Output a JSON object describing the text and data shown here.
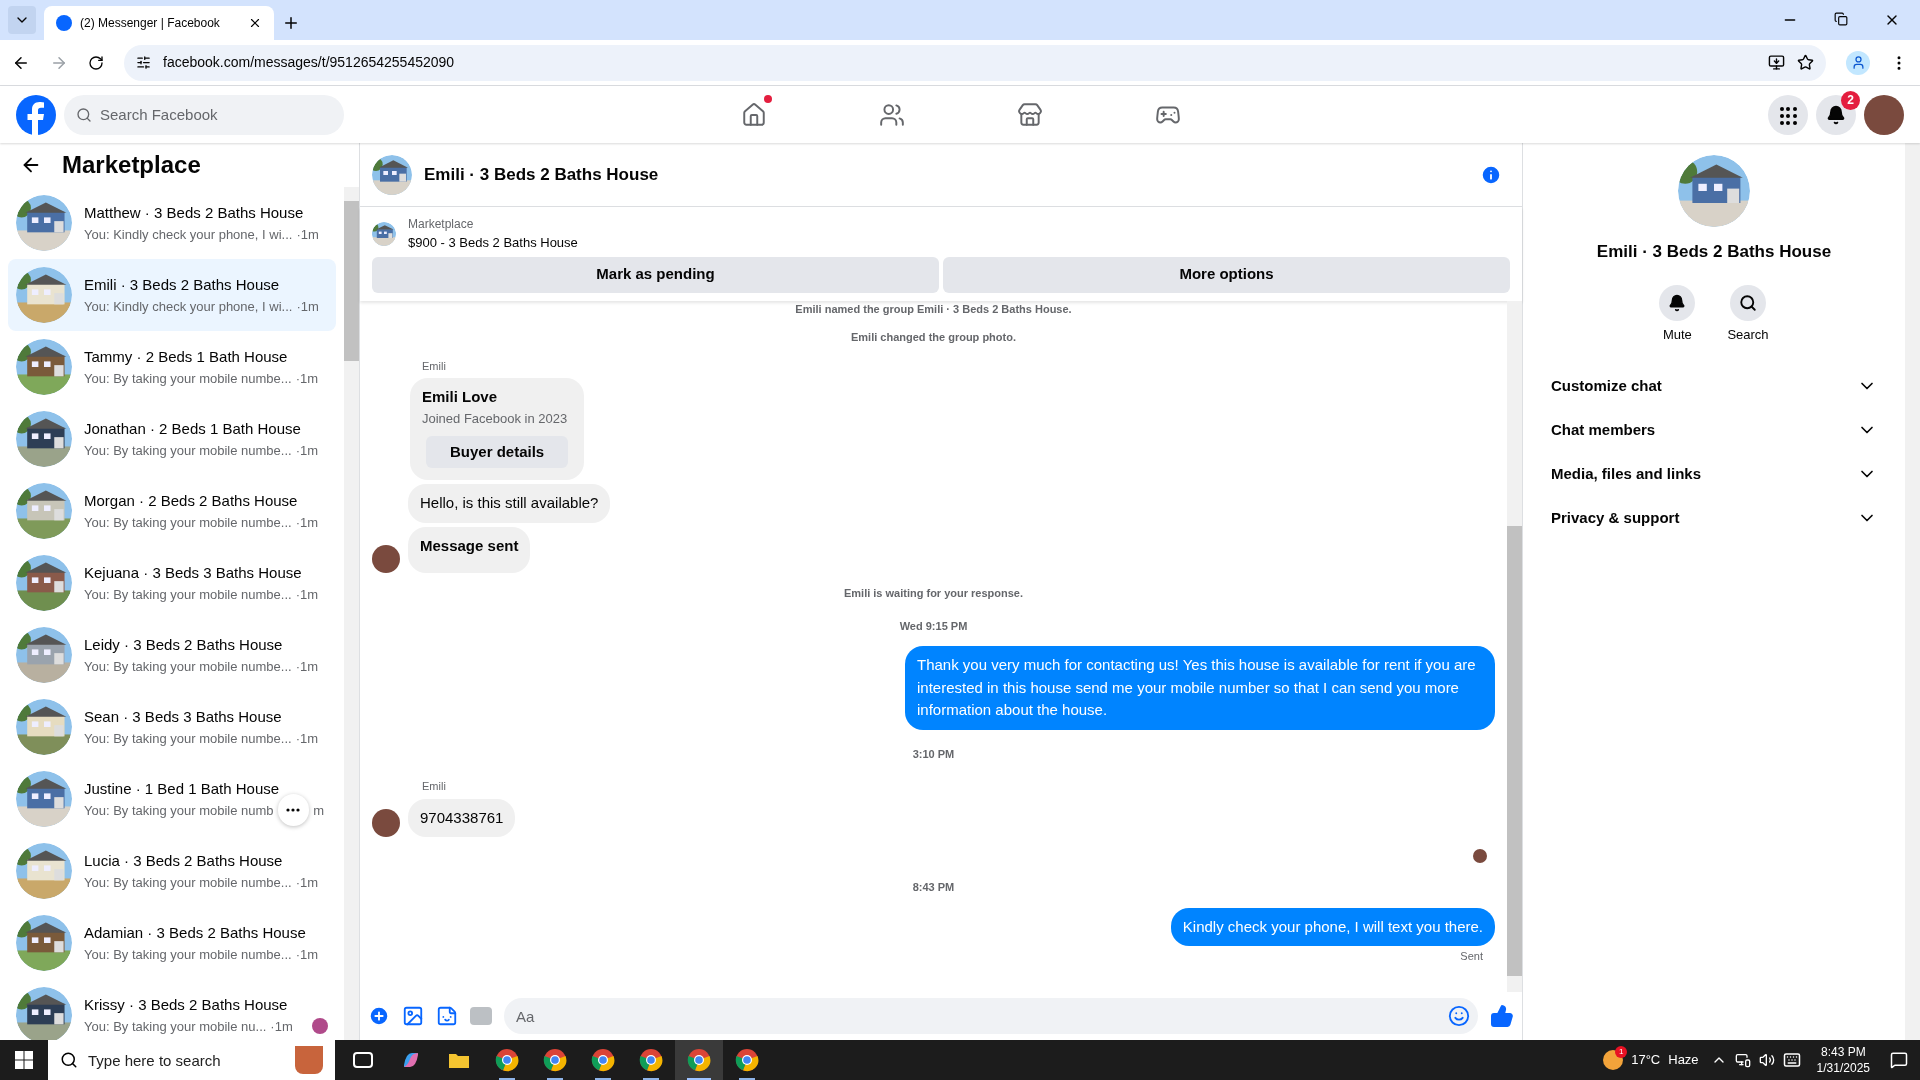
{
  "browser": {
    "tab_title": "(2) Messenger | Facebook",
    "url": "facebook.com/messages/t/9512654255452090"
  },
  "header": {
    "search_placeholder": "Search Facebook",
    "nav": [
      {
        "kind": "home",
        "dot": true
      },
      {
        "kind": "friends",
        "dot": false
      },
      {
        "kind": "marketplace",
        "dot": false
      },
      {
        "kind": "gaming",
        "dot": false
      }
    ],
    "notification_count": "2"
  },
  "sidebar": {
    "title": "Marketplace",
    "conversations": [
      {
        "title": "Matthew · 3 Beds 2 Baths House",
        "preview": "You: Kindly check your phone, I wi...",
        "time": "·1m",
        "selected": false,
        "hovered": false,
        "seen": false
      },
      {
        "title": "Emili · 3 Beds 2 Baths House",
        "preview": "You: Kindly check your phone, I wi...",
        "time": "·1m",
        "selected": true,
        "hovered": false,
        "seen": false
      },
      {
        "title": "Tammy · 2 Beds 1 Bath House",
        "preview": "You: By taking your mobile numbe...",
        "time": "·1m",
        "selected": false,
        "hovered": false,
        "seen": false
      },
      {
        "title": "Jonathan · 2 Beds 1 Bath House",
        "preview": "You: By taking your mobile numbe...",
        "time": "·1m",
        "selected": false,
        "hovered": false,
        "seen": false
      },
      {
        "title": "Morgan · 2 Beds 2 Baths House",
        "preview": "You: By taking your mobile numbe...",
        "time": "·1m",
        "selected": false,
        "hovered": false,
        "seen": false
      },
      {
        "title": "Kejuana · 3 Beds 3 Baths House",
        "preview": "You: By taking your mobile numbe...",
        "time": "·1m",
        "selected": false,
        "hovered": false,
        "seen": false
      },
      {
        "title": "Leidy · 3 Beds 2 Baths House",
        "preview": "You: By taking your mobile numbe...",
        "time": "·1m",
        "selected": false,
        "hovered": false,
        "seen": false
      },
      {
        "title": "Sean · 3 Beds 3 Baths House",
        "preview": "You: By taking your mobile numbe...",
        "time": "·1m",
        "selected": false,
        "hovered": false,
        "seen": false
      },
      {
        "title": "Justine · 1 Bed 1 Bath House",
        "preview": "You: By taking your mobile numb",
        "time": "m",
        "selected": false,
        "hovered": true,
        "seen": false
      },
      {
        "title": "Lucia · 3 Beds 2 Baths House",
        "preview": "You: By taking your mobile numbe...",
        "time": "·1m",
        "selected": false,
        "hovered": false,
        "seen": false
      },
      {
        "title": "Adamian · 3 Beds 2 Baths House",
        "preview": "You: By taking your mobile numbe...",
        "time": "·1m",
        "selected": false,
        "hovered": false,
        "seen": false
      },
      {
        "title": "Krissy · 3 Beds 2 Baths House",
        "preview": "You: By taking your mobile nu...",
        "time": "·1m",
        "selected": false,
        "hovered": false,
        "seen": true
      }
    ]
  },
  "chat": {
    "title": "Emili · 3 Beds 2 Baths House",
    "listing": {
      "label": "Marketplace",
      "title": "$900 - 3 Beds 2 Baths House"
    },
    "actions": [
      "Mark as pending",
      "More options"
    ],
    "messages": [
      {
        "kind": "system",
        "text": "Emili named the group Emili · 3 Beds 2 Baths House."
      },
      {
        "kind": "system",
        "text": "Emili changed the group photo."
      },
      {
        "kind": "profile_card",
        "sender": "Emili",
        "name": "Emili Love",
        "subtitle": "Joined Facebook in 2023",
        "button": "Buyer details"
      },
      {
        "kind": "incoming",
        "text": "Hello, is this still available?",
        "avatar": false
      },
      {
        "kind": "incoming",
        "text": "Message sent",
        "avatar": true,
        "bold": true
      },
      {
        "kind": "system",
        "text": "Emili is waiting for your response."
      },
      {
        "kind": "time",
        "text": "Wed 9:15 PM"
      },
      {
        "kind": "outgoing",
        "text": "Thank you very much for contacting us! Yes this house is available for rent if you are interested in this house send me your mobile number so that I can send you more information about the house."
      },
      {
        "kind": "time",
        "text": "3:10 PM"
      },
      {
        "kind": "incoming",
        "sender": "Emili",
        "text": "9704338761",
        "avatar": true
      },
      {
        "kind": "read_receipt"
      },
      {
        "kind": "time",
        "text": "8:43 PM"
      },
      {
        "kind": "outgoing",
        "text": "Kindly check your phone, I will text you there.",
        "status": "Sent"
      }
    ],
    "composer_placeholder": "Aa"
  },
  "details": {
    "title": "Emili · 3 Beds 2 Baths House",
    "actions": [
      {
        "kind": "mute",
        "label": "Mute"
      },
      {
        "kind": "search",
        "label": "Search"
      }
    ],
    "sections": [
      {
        "label": "Customize chat",
        "expanded": false
      },
      {
        "label": "Chat members",
        "expanded": false
      },
      {
        "label": "Media, files and links",
        "expanded": false
      },
      {
        "label": "Privacy & support",
        "expanded": false
      }
    ]
  },
  "taskbar": {
    "search_placeholder": "Type here to search",
    "apps": [
      {
        "kind": "task_view",
        "active": false
      },
      {
        "kind": "copilot",
        "active": false
      },
      {
        "kind": "explorer",
        "active": false
      },
      {
        "kind": "chrome",
        "active": false
      },
      {
        "kind": "chrome",
        "active": false
      },
      {
        "kind": "chrome",
        "active": false
      },
      {
        "kind": "chrome",
        "active": false
      },
      {
        "kind": "chrome",
        "active": true
      },
      {
        "kind": "chrome",
        "active": false
      }
    ],
    "weather_badge": "1",
    "temperature": "17°C",
    "condition": "Haze",
    "time": "8:43 PM",
    "date": "1/31/2025"
  }
}
